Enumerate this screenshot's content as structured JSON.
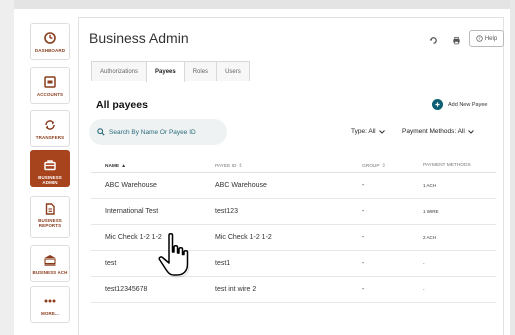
{
  "sidebar": {
    "items": [
      {
        "label": "DASHBOARD",
        "icon": "dashboard-icon"
      },
      {
        "label": "ACCOUNTS",
        "icon": "accounts-icon"
      },
      {
        "label": "TRANSFERS",
        "icon": "transfers-icon"
      },
      {
        "label": "BUSINESS ADMIN",
        "icon": "briefcase-icon",
        "active": true
      },
      {
        "label": "BUSINESS REPORTS",
        "icon": "report-icon"
      },
      {
        "label": "BUSINESS ACH",
        "icon": "bank-ach-icon"
      },
      {
        "label": "MORE...",
        "icon": "more-icon"
      }
    ]
  },
  "header": {
    "title": "Business Admin",
    "help_label": "Help"
  },
  "tabs": [
    {
      "label": "Authorizations"
    },
    {
      "label": "Payees",
      "active": true
    },
    {
      "label": "Roles"
    },
    {
      "label": "Users"
    }
  ],
  "payees": {
    "title": "All payees",
    "add_label": "Add New Payee",
    "search_placeholder": "Search By Name Or Payee ID",
    "type_filter": "Type: All",
    "payment_filter": "Payment Methods: All",
    "columns": [
      "NAME",
      "PAYEE ID",
      "GROUP",
      "PAYMENT METHODS"
    ],
    "rows": [
      {
        "name": "ABC Warehouse",
        "payee_id": "ABC Warehouse",
        "group": "-",
        "methods": "1 ACH"
      },
      {
        "name": "International Test",
        "payee_id": "test123",
        "group": "-",
        "methods": "1 WIRE"
      },
      {
        "name": "Mic Check 1-2 1-2",
        "payee_id": "Mic Check 1-2 1-2",
        "group": "-",
        "methods": "2 ACH"
      },
      {
        "name": "test",
        "payee_id": "test1",
        "group": "-",
        "methods": "-"
      },
      {
        "name": "test12345678",
        "payee_id": "test int wire 2",
        "group": "-",
        "methods": "-"
      }
    ]
  },
  "colors": {
    "accent": "#a7441d",
    "teal": "#0e5f73",
    "search_bg": "#eef2f2"
  }
}
